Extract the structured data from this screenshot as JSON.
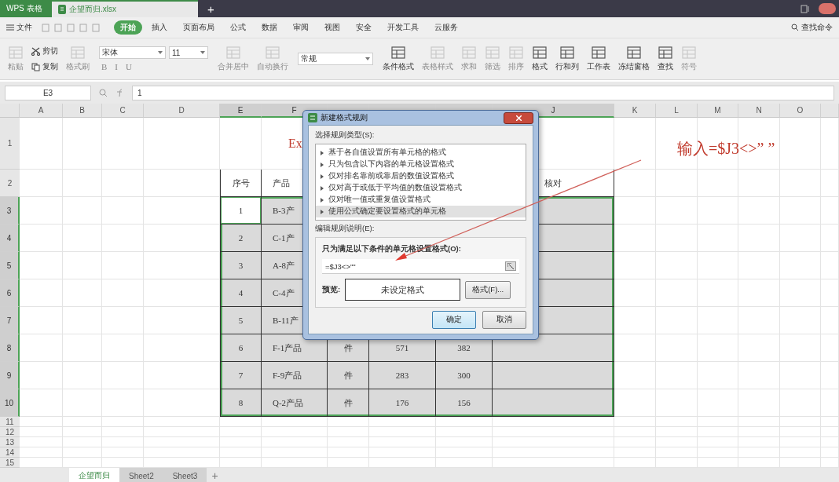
{
  "title_bar": {
    "tabs": [
      {
        "label": "WPS 表格",
        "kind": "app",
        "selected": false
      },
      {
        "label": "企望而归.xlsx",
        "kind": "document",
        "selected": true
      }
    ],
    "new_tab": "+"
  },
  "menu": {
    "file": "文件",
    "tabs": [
      {
        "label": "开始",
        "selected": true
      },
      {
        "label": "插入",
        "selected": false
      },
      {
        "label": "页面布局",
        "selected": false
      },
      {
        "label": "公式",
        "selected": false
      },
      {
        "label": "数据",
        "selected": false
      },
      {
        "label": "审阅",
        "selected": false
      },
      {
        "label": "视图",
        "selected": false
      },
      {
        "label": "安全",
        "selected": false
      },
      {
        "label": "开发工具",
        "selected": false
      },
      {
        "label": "云服务",
        "selected": false
      }
    ],
    "search": "查找命令"
  },
  "ribbon": [
    {
      "kind": "large",
      "label": "粘贴",
      "disabled": true
    },
    {
      "kind": "stack",
      "items": [
        {
          "label": "剪切",
          "disabled": false
        },
        {
          "label": "复制",
          "disabled": false
        }
      ]
    },
    {
      "kind": "large",
      "label": "格式刷",
      "disabled": true
    },
    {
      "kind": "font",
      "font": "宋体",
      "size": "11",
      "styles": [
        {
          "label": "B",
          "disabled": true
        },
        {
          "label": "I",
          "disabled": true
        },
        {
          "label": "U",
          "disabled": true
        }
      ]
    },
    {
      "kind": "large",
      "label": "合并居中",
      "disabled": true
    },
    {
      "kind": "large",
      "label": "自动换行",
      "disabled": true
    },
    {
      "kind": "number",
      "value": "常规"
    },
    {
      "kind": "large",
      "label": "条件格式",
      "disabled": false
    },
    {
      "kind": "large",
      "label": "表格样式",
      "disabled": true
    },
    {
      "kind": "large",
      "label": "求和",
      "disabled": true
    },
    {
      "kind": "large",
      "label": "筛选",
      "disabled": true
    },
    {
      "kind": "large",
      "label": "排序",
      "disabled": true
    },
    {
      "kind": "large",
      "label": "格式",
      "disabled": false
    },
    {
      "kind": "large",
      "label": "行和列",
      "disabled": false
    },
    {
      "kind": "large",
      "label": "工作表",
      "disabled": false
    },
    {
      "kind": "large",
      "label": "冻结窗格",
      "disabled": false
    },
    {
      "kind": "large",
      "label": "查找",
      "disabled": false
    },
    {
      "kind": "large",
      "label": "符号",
      "disabled": true
    }
  ],
  "formula_bar": {
    "name_box": "E3",
    "formula": "1"
  },
  "columns": [
    {
      "label": "A",
      "selected": false
    },
    {
      "label": "B",
      "selected": false
    },
    {
      "label": "C",
      "selected": false
    },
    {
      "label": "D",
      "selected": false
    },
    {
      "label": "E",
      "selected": true
    },
    {
      "label": "F",
      "selected": true
    },
    {
      "selected": true
    },
    {
      "selected": true
    },
    {
      "selected": true
    },
    {
      "label": "J",
      "selected": true
    },
    {
      "label": "K",
      "selected": false
    },
    {
      "label": "L",
      "selected": false
    },
    {
      "label": "M",
      "selected": false
    },
    {
      "label": "N",
      "selected": false
    },
    {
      "label": "O",
      "selected": false
    }
  ],
  "rows": [
    {
      "label": "1",
      "selected": false,
      "bordered": false,
      "cells": [
        null,
        null,
        null,
        null,
        null,
        {
          "text": "Ex",
          "kind": "title",
          "active": false
        }
      ]
    },
    {
      "label": "2",
      "selected": false,
      "bordered": true,
      "cells": [
        null,
        null,
        null,
        null,
        {
          "text": "序号",
          "kind": "header",
          "active": false
        },
        {
          "text": "产品",
          "kind": "header",
          "active": false
        },
        null,
        null,
        null,
        {
          "text": "核对",
          "kind": "header",
          "active": false
        }
      ]
    },
    {
      "label": "3",
      "selected": true,
      "bordered": true,
      "cells": [
        null,
        null,
        null,
        null,
        {
          "text": "1",
          "kind": "data",
          "active": true
        },
        {
          "text": "B-3产",
          "kind": "data",
          "active": false
        }
      ]
    },
    {
      "label": "4",
      "selected": true,
      "bordered": true,
      "cells": [
        null,
        null,
        null,
        null,
        {
          "text": "2",
          "kind": "data",
          "active": false
        },
        {
          "text": "C-1产",
          "kind": "data",
          "active": false
        }
      ]
    },
    {
      "label": "5",
      "selected": true,
      "bordered": true,
      "cells": [
        null,
        null,
        null,
        null,
        {
          "text": "3",
          "kind": "data",
          "active": false
        },
        {
          "text": "A-8产",
          "kind": "data",
          "active": false
        }
      ]
    },
    {
      "label": "6",
      "selected": true,
      "bordered": true,
      "cells": [
        null,
        null,
        null,
        null,
        {
          "text": "4",
          "kind": "data",
          "active": false
        },
        {
          "text": "C-4产",
          "kind": "data",
          "active": false
        }
      ]
    },
    {
      "label": "7",
      "selected": true,
      "bordered": true,
      "cells": [
        null,
        null,
        null,
        null,
        {
          "text": "5",
          "kind": "data",
          "active": false
        },
        {
          "text": "B-11产",
          "kind": "data",
          "active": false
        }
      ]
    },
    {
      "label": "8",
      "selected": true,
      "bordered": true,
      "cells": [
        null,
        null,
        null,
        null,
        {
          "text": "6",
          "kind": "data",
          "active": false
        },
        {
          "text": "F-1产品",
          "kind": "data",
          "active": false
        },
        {
          "text": "件",
          "kind": "data",
          "active": false
        },
        {
          "text": "571",
          "kind": "data",
          "active": false
        },
        {
          "text": "382",
          "kind": "data",
          "active": false
        }
      ]
    },
    {
      "label": "9",
      "selected": true,
      "bordered": true,
      "cells": [
        null,
        null,
        null,
        null,
        {
          "text": "7",
          "kind": "data",
          "active": false
        },
        {
          "text": "F-9产品",
          "kind": "data",
          "active": false
        },
        {
          "text": "件",
          "kind": "data",
          "active": false
        },
        {
          "text": "283",
          "kind": "data",
          "active": false
        },
        {
          "text": "300",
          "kind": "data",
          "active": false
        }
      ]
    },
    {
      "label": "10",
      "selected": true,
      "bordered": true,
      "cells": [
        null,
        null,
        null,
        null,
        {
          "text": "8",
          "kind": "data",
          "active": false
        },
        {
          "text": "Q-2产品",
          "kind": "data",
          "active": false
        },
        {
          "text": "件",
          "kind": "data",
          "active": false
        },
        {
          "text": "176",
          "kind": "data",
          "active": false
        },
        {
          "text": "156",
          "kind": "data",
          "active": false
        }
      ]
    },
    {
      "label": "11",
      "selected": false,
      "bordered": false,
      "cells": []
    },
    {
      "label": "12",
      "selected": false,
      "bordered": false,
      "cells": []
    },
    {
      "label": "13",
      "selected": false,
      "bordered": false,
      "cells": []
    },
    {
      "label": "14",
      "selected": false,
      "bordered": false,
      "cells": []
    },
    {
      "label": "15",
      "selected": false,
      "bordered": false,
      "cells": []
    }
  ],
  "sheet_tabs": [
    {
      "label": "企望而归",
      "selected": true
    },
    {
      "label": "Sheet2",
      "selected": false
    },
    {
      "label": "Sheet3",
      "selected": false
    }
  ],
  "add_sheet": "+",
  "annotation": "输入=$J3<>” ”",
  "dialog": {
    "title": "新建格式规则",
    "rule_type_label": "选择规则类型(S):",
    "rule_types": [
      {
        "label": "基于各自值设置所有单元格的格式",
        "selected": false
      },
      {
        "label": "只为包含以下内容的单元格设置格式",
        "selected": false
      },
      {
        "label": "仅对排名靠前或靠后的数值设置格式",
        "selected": false
      },
      {
        "label": "仅对高于或低于平均值的数值设置格式",
        "selected": false
      },
      {
        "label": "仅对唯一值或重复值设置格式",
        "selected": false
      },
      {
        "label": "使用公式确定要设置格式的单元格",
        "selected": true
      }
    ],
    "edit_label": "编辑规则说明(E):",
    "condition_label": "只为满足以下条件的单元格设置格式(O):",
    "formula": "=$J3<>\"\"",
    "preview_label": "预览:",
    "preview_text": "未设定格式",
    "format_button": "格式(F)...",
    "buttons": [
      {
        "label": "确定",
        "default": true
      },
      {
        "label": "取消",
        "default": false
      }
    ]
  }
}
